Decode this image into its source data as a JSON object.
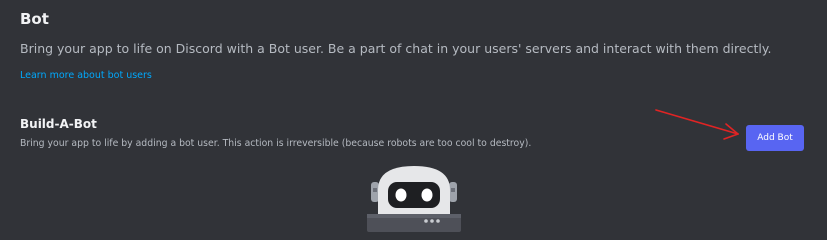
{
  "header": {
    "title": "Bot",
    "subtitle": "Bring your app to life on Discord with a Bot user. Be a part of chat in your users' servers and interact with them directly.",
    "learn_more_link": "Learn more about bot users"
  },
  "build_a_bot": {
    "title": "Build-A-Bot",
    "description": "Bring your app to life by adding a bot user. This action is irreversible (because robots are too cool to destroy).",
    "add_bot_label": "Add Bot"
  },
  "colors": {
    "background": "#313338",
    "accent": "#5865f2",
    "link": "#00a8fc",
    "annotation_arrow": "#e02424"
  },
  "icons": {
    "annotation": "red-arrow-icon",
    "illustration": "robot-illustration"
  }
}
